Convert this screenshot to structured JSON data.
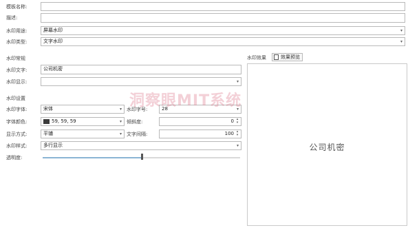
{
  "form": {
    "name_label": "模板名称:",
    "name_value": "",
    "desc_label": "描述:",
    "desc_value": "",
    "usage_label": "水印用途:",
    "usage_value": "屏幕水印",
    "type_label": "水印类型:",
    "type_value": "文字水印"
  },
  "content_section": {
    "title": "水印常规",
    "text_label": "水印文字:",
    "text_value": "公司机密",
    "display_label": "水印显示:",
    "display_value": ""
  },
  "settings_section": {
    "title": "水印设置",
    "font_label": "水印字体:",
    "font_value": "宋体",
    "size_label": "水印字号:",
    "size_value": "28",
    "color_label": "字体颜色:",
    "color_value": "59, 59, 59",
    "color_hex": "#3b3b3b",
    "tilt_label": "倾斜度:",
    "tilt_value": "0",
    "mode_label": "显示方式:",
    "mode_value": "平铺",
    "spacing_label": "文字间隔:",
    "spacing_value": "100",
    "style_label": "水印样式:",
    "style_value": "多行显示",
    "opacity_label": "透明度:",
    "opacity_percent": 50
  },
  "preview": {
    "label": "水印效果",
    "button_label": "效果预览",
    "text": "公司机密"
  },
  "overlay_watermark": "洞察眼MIT系统"
}
